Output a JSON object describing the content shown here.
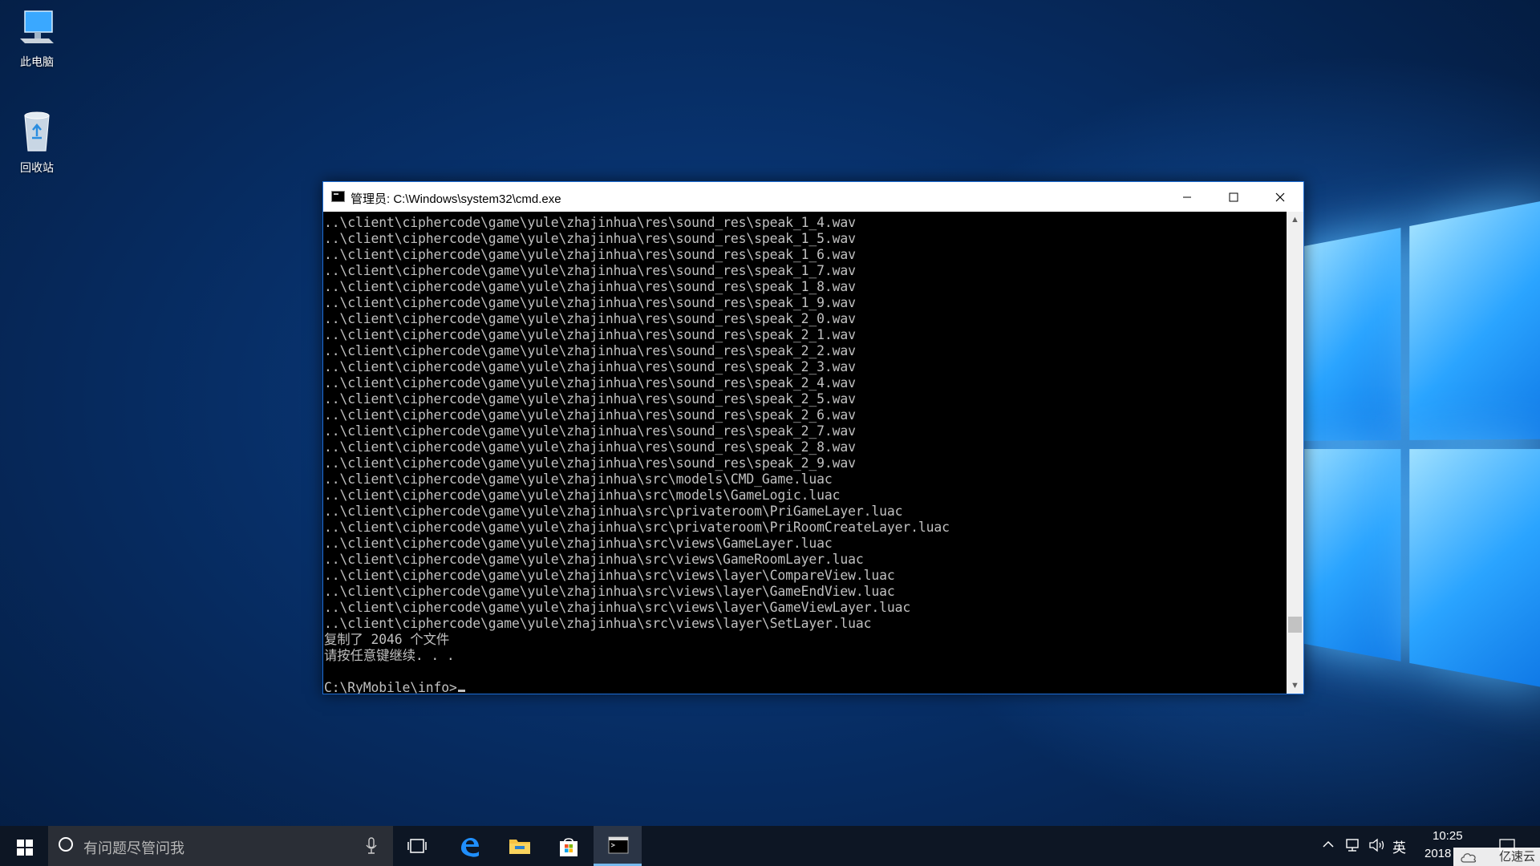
{
  "desktop": {
    "icons": [
      {
        "label": "此电脑",
        "icon": "this-pc-icon"
      },
      {
        "label": "回收站",
        "icon": "recycle-bin-icon"
      }
    ]
  },
  "cmd": {
    "title": "管理员: C:\\Windows\\system32\\cmd.exe",
    "lines": [
      "..\\client\\ciphercode\\game\\yule\\zhajinhua\\res\\sound_res\\speak_1_4.wav",
      "..\\client\\ciphercode\\game\\yule\\zhajinhua\\res\\sound_res\\speak_1_5.wav",
      "..\\client\\ciphercode\\game\\yule\\zhajinhua\\res\\sound_res\\speak_1_6.wav",
      "..\\client\\ciphercode\\game\\yule\\zhajinhua\\res\\sound_res\\speak_1_7.wav",
      "..\\client\\ciphercode\\game\\yule\\zhajinhua\\res\\sound_res\\speak_1_8.wav",
      "..\\client\\ciphercode\\game\\yule\\zhajinhua\\res\\sound_res\\speak_1_9.wav",
      "..\\client\\ciphercode\\game\\yule\\zhajinhua\\res\\sound_res\\speak_2_0.wav",
      "..\\client\\ciphercode\\game\\yule\\zhajinhua\\res\\sound_res\\speak_2_1.wav",
      "..\\client\\ciphercode\\game\\yule\\zhajinhua\\res\\sound_res\\speak_2_2.wav",
      "..\\client\\ciphercode\\game\\yule\\zhajinhua\\res\\sound_res\\speak_2_3.wav",
      "..\\client\\ciphercode\\game\\yule\\zhajinhua\\res\\sound_res\\speak_2_4.wav",
      "..\\client\\ciphercode\\game\\yule\\zhajinhua\\res\\sound_res\\speak_2_5.wav",
      "..\\client\\ciphercode\\game\\yule\\zhajinhua\\res\\sound_res\\speak_2_6.wav",
      "..\\client\\ciphercode\\game\\yule\\zhajinhua\\res\\sound_res\\speak_2_7.wav",
      "..\\client\\ciphercode\\game\\yule\\zhajinhua\\res\\sound_res\\speak_2_8.wav",
      "..\\client\\ciphercode\\game\\yule\\zhajinhua\\res\\sound_res\\speak_2_9.wav",
      "..\\client\\ciphercode\\game\\yule\\zhajinhua\\src\\models\\CMD_Game.luac",
      "..\\client\\ciphercode\\game\\yule\\zhajinhua\\src\\models\\GameLogic.luac",
      "..\\client\\ciphercode\\game\\yule\\zhajinhua\\src\\privateroom\\PriGameLayer.luac",
      "..\\client\\ciphercode\\game\\yule\\zhajinhua\\src\\privateroom\\PriRoomCreateLayer.luac",
      "..\\client\\ciphercode\\game\\yule\\zhajinhua\\src\\views\\GameLayer.luac",
      "..\\client\\ciphercode\\game\\yule\\zhajinhua\\src\\views\\GameRoomLayer.luac",
      "..\\client\\ciphercode\\game\\yule\\zhajinhua\\src\\views\\layer\\CompareView.luac",
      "..\\client\\ciphercode\\game\\yule\\zhajinhua\\src\\views\\layer\\GameEndView.luac",
      "..\\client\\ciphercode\\game\\yule\\zhajinhua\\src\\views\\layer\\GameViewLayer.luac",
      "..\\client\\ciphercode\\game\\yule\\zhajinhua\\src\\views\\layer\\SetLayer.luac",
      "复制了 2046 个文件",
      "请按任意键继续. . .",
      "",
      "C:\\RyMobile\\info>"
    ]
  },
  "taskbar": {
    "search_placeholder": "有问题尽管问我",
    "apps": [
      "task-view",
      "edge",
      "file-explorer",
      "store",
      "cmd"
    ],
    "tray": {
      "ime": "英",
      "time": "10:25",
      "date": "2018"
    }
  },
  "watermark": "亿速云",
  "colors": {
    "console_bg": "#000000",
    "console_fg": "#c0c0c0",
    "taskbar_bg": "#0d1624",
    "accent": "#1e6ed6"
  }
}
